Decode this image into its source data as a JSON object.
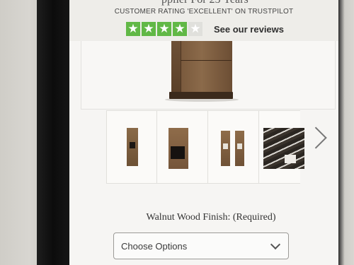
{
  "banner": {
    "partial_heading": "pplier For 25 Years",
    "rating_text": "CUSTOMER RATING 'EXCELLENT' ON TRUSTPILOT",
    "stars": [
      "★",
      "★",
      "★",
      "★",
      "★"
    ],
    "reviews_link": "See our reviews"
  },
  "gallery": {
    "thumbnails": [
      "tall-cabinet",
      "drawer-cabinet",
      "cabinet-pair",
      "interior-shelf"
    ],
    "next_icon": "chevron-right-icon"
  },
  "product_options": {
    "label": "Walnut Wood Finish:",
    "required": "(Required)",
    "select_value": "Choose Options"
  },
  "colors": {
    "trustpilot_green": "#61b846",
    "wood": "#7a5a3d"
  }
}
